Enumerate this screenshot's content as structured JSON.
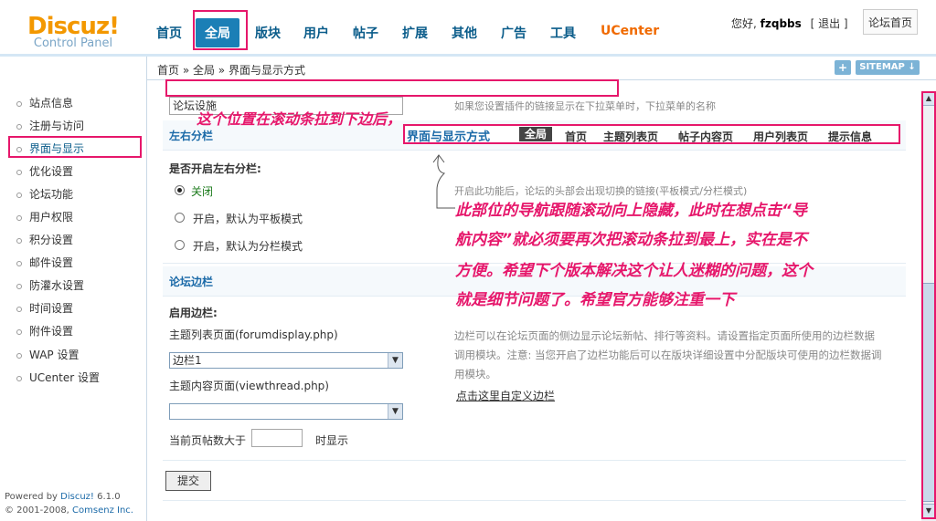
{
  "header": {
    "logo_main": "Discuz!",
    "logo_sub": "Control Panel",
    "nav": [
      "首页",
      "全局",
      "版块",
      "用户",
      "帖子",
      "扩展",
      "其他",
      "广告",
      "工具",
      "UCenter"
    ],
    "active_nav": "全局",
    "greeting": "您好,",
    "username": "fzqbbs",
    "logout": "[ 退出 ]",
    "home_button": "论坛首页"
  },
  "breadcrumb": "首页 » 全局 » 界面与显示方式",
  "sitemap_button": "SITEMAP",
  "plus_button": "+",
  "sidebar": {
    "items": [
      "站点信息",
      "注册与访问",
      "界面与显示",
      "优化设置",
      "论坛功能",
      "用户权限",
      "积分设置",
      "邮件设置",
      "防灌水设置",
      "时间设置",
      "附件设置",
      "WAP 设置",
      "UCenter 设置"
    ],
    "active": "界面与显示",
    "powered_prefix": "Powered by ",
    "powered_name": "Discuz!",
    "powered_version": " 6.1.0",
    "copyright_prefix": "© 2001-2008, ",
    "copyright_name": "Comsenz Inc."
  },
  "main": {
    "top_input_value": "论坛设施",
    "top_hint": "如果您设置插件的链接显示在下拉菜单时，下拉菜单的名称",
    "section1_title": "左右分栏",
    "section1_question": "是否开启左右分栏:",
    "radio_options": [
      "关闭",
      "开启，默认为平板模式",
      "开启，默认为分栏模式"
    ],
    "radio_checked": 0,
    "section1_hint": "开启此功能后，论坛的头部会出现切换的链接(平板模式/分栏模式)",
    "section2_title": "论坛边栏",
    "enable_sidebar_label": "启用边栏:",
    "forumdisplay_label": "主题列表页面(forumdisplay.php)",
    "forumdisplay_value": "边栏1",
    "viewthread_label": "主题内容页面(viewthread.php)",
    "viewthread_value": "",
    "posts_prefix": "当前页帖数大于",
    "posts_value": "",
    "posts_suffix": "时显示",
    "sidebar_hint_lines": [
      "边栏可以在论坛页面的侧边显示论坛新帖、排行等资料。请设置指定页面所使用的边栏数据",
      "调用模块。注意: 当您开启了边栏功能后可以在版块详细设置中分配版块可使用的边栏数据调",
      "用模块。"
    ],
    "custom_sidebar_link": "点击这里自定义边栏",
    "submit_label": "提交"
  },
  "subnav": {
    "title": "界面与显示方式",
    "items": [
      "全局",
      "首页",
      "主题列表页",
      "帖子内容页",
      "用户列表页",
      "提示信息"
    ],
    "active": "全局"
  },
  "annotations": {
    "top_note": "这个位置在滚动条拉到下边后，",
    "main_note_lines": [
      "此部位的导航跟随滚动向上隐藏，此时在想点击“导",
      "航内容”就必须要再次把滚动条拉到最上，实在是不",
      "方便。希望下个版本解决这个让人迷糊的问题，这个",
      "就是细节问题了。希望官方能够注重一下"
    ]
  },
  "colors": {
    "accent": "#1b7fb6",
    "annotation": "#e6176b",
    "logo": "#f39800",
    "link": "#1b6aa8"
  }
}
